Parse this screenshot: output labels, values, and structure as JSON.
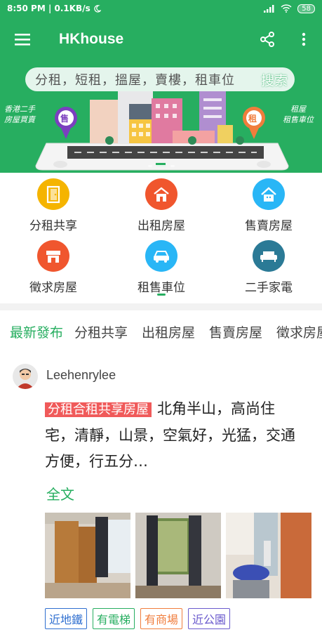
{
  "status_bar": {
    "time_speed": "8:50 PM | 0.1KB/s",
    "battery": "58"
  },
  "app_bar": {
    "title": "HKhouse",
    "icons": [
      "menu-icon",
      "share-icon",
      "more-vert-icon"
    ]
  },
  "banner": {
    "search_placeholder": "分租，短租，搵屋，賣樓，租車位",
    "search_label": "搜索",
    "left_caption": [
      "香港二手",
      "房屋買賣"
    ],
    "right_caption": [
      "租屋",
      "租售車位"
    ],
    "left_badge": "售",
    "right_badge": "租"
  },
  "categories": [
    {
      "label": "分租共享",
      "color": "#f5b400",
      "icon": "door-icon"
    },
    {
      "label": "出租房屋",
      "color": "#f0562e",
      "icon": "house-icon"
    },
    {
      "label": "售賣房屋",
      "color": "#29b6f6",
      "icon": "house-icon"
    },
    {
      "label": "徵求房屋",
      "color": "#f0562e",
      "icon": "store-icon"
    },
    {
      "label": "租售車位",
      "color": "#29b6f6",
      "icon": "car-icon"
    },
    {
      "label": "二手家電",
      "color": "#2b7a96",
      "icon": "sofa-icon"
    }
  ],
  "tabs": [
    "最新發布",
    "分租共享",
    "出租房屋",
    "售賣房屋",
    "徵求房屋"
  ],
  "post": {
    "username": "Leehenrylee",
    "category": "分租合租共享房屋",
    "body": "北角半山，高尚住宅，清靜，山景，空氣好，光猛，交通方便，行五分…",
    "read_more": "全文",
    "tags": [
      {
        "label": "近地鐵",
        "color": "#2f6fd0"
      },
      {
        "label": "有電梯",
        "color": "#27ae60"
      },
      {
        "label": "有商場",
        "color": "#f07d3c"
      },
      {
        "label": "近公園",
        "color": "#6a5acd"
      }
    ]
  }
}
